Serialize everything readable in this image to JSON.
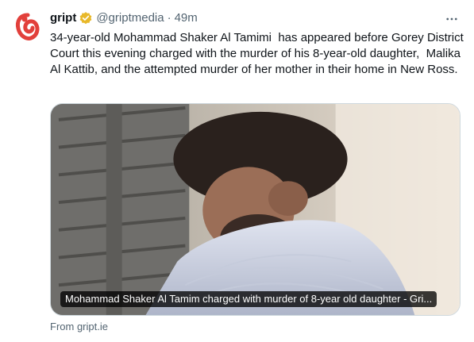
{
  "tweet": {
    "display_name": "gript",
    "handle": "@griptmedia",
    "separator": "·",
    "time": "49m",
    "text": "34-year-old Mohammad Shaker Al Tamimi  has appeared before Gorey District Court this evening charged with the murder of his 8-year-old daughter,  Malika Al Kattib, and the attempted murder of her mother in their home in New Ross.",
    "card": {
      "title": "Mohammad Shaker Al Tamim charged with murder of 8-year old daughter - Gri..."
    },
    "source": "From gript.ie"
  },
  "colors": {
    "avatar_brand": "#e2403b",
    "verified_badge": "#e8b829",
    "secondary_text": "#536471"
  },
  "icons": {
    "avatar": "gript-logo",
    "verified": "verified-badge-icon",
    "more": "more-options-icon"
  }
}
